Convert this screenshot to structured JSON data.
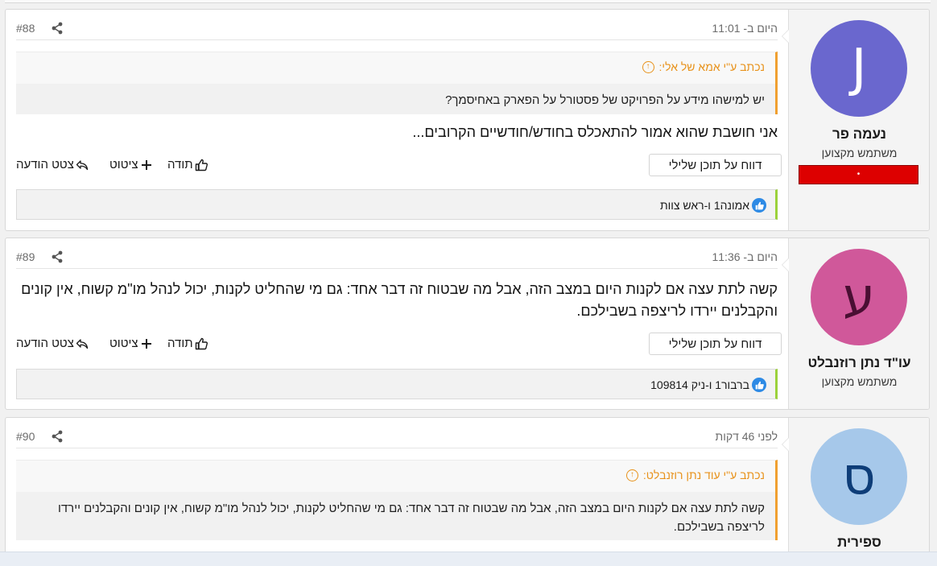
{
  "posts": [
    {
      "number": "#88",
      "date": "היום ב- 11:01",
      "user": {
        "name": "נעמה פר",
        "title": "משתמש מקצוען",
        "avatar_letter": "J",
        "avatar_bg": "#6a67ce",
        "avatar_fg": "#ffffff",
        "banner": "•"
      },
      "quote": {
        "author": "נכתב ע\"י אמא של אלי:",
        "text": "יש למישהו מידע על הפרויקט של פסטורל על הפארק באחיסמך?"
      },
      "text": "אני חושבת שהוא אמור להתאכלס בחודש/חודשיים הקרובים...",
      "actions": {
        "report": "דווח על תוכן שלילי",
        "thanks": "תודה",
        "quote": "ציטוט",
        "quote_msg": "צטט הודעה"
      },
      "likes": "אמונה1 ו-ראש צוות"
    },
    {
      "number": "#89",
      "date": "היום ב- 11:36",
      "user": {
        "name": "עו\"ד נתן רוזנבלט",
        "title": "משתמש מקצוען",
        "avatar_letter": "ע",
        "avatar_bg": "#d0589a",
        "avatar_fg": "#4a0f33"
      },
      "text": "קשה לתת עצה אם לקנות היום במצב הזה, אבל מה שבטוח זה דבר אחד: גם מי שהחליט לקנות, יכול לנהל מו\"מ קשוח, אין קונים והקבלנים יירדו לריצפה בשבילכם.",
      "actions": {
        "report": "דווח על תוכן שלילי",
        "thanks": "תודה",
        "quote": "ציטוט",
        "quote_msg": "צטט הודעה"
      },
      "likes": "ברבור1 ו-ניק 109814"
    },
    {
      "number": "#90",
      "date": "לפני 46 דקות",
      "user": {
        "name": "ספירית",
        "avatar_letter": "ס",
        "avatar_bg": "#a6c8ea",
        "avatar_fg": "#0e3d78"
      },
      "quote": {
        "author": "נכתב ע\"י עוד נתן רוזנבלט:",
        "text": "קשה לתת עצה אם לקנות היום במצב הזה, אבל מה שבטוח זה דבר אחד: גם מי שהחליט לקנות, יכול לנהל מו\"מ קשוח, אין קונים והקבלנים יירדו לריצפה בשבילכם."
      }
    }
  ]
}
